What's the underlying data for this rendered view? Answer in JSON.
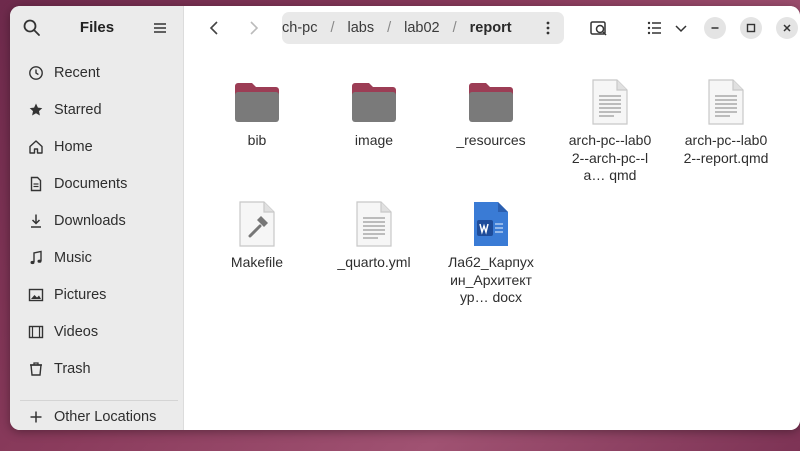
{
  "sidebar": {
    "title": "Files",
    "items": [
      {
        "label": "Recent",
        "icon": "clock-icon"
      },
      {
        "label": "Starred",
        "icon": "star-icon"
      },
      {
        "label": "Home",
        "icon": "home-icon"
      },
      {
        "label": "Documents",
        "icon": "document-icon"
      },
      {
        "label": "Downloads",
        "icon": "download-icon"
      },
      {
        "label": "Music",
        "icon": "music-note-icon"
      },
      {
        "label": "Pictures",
        "icon": "picture-icon"
      },
      {
        "label": "Videos",
        "icon": "film-icon"
      },
      {
        "label": "Trash",
        "icon": "trash-icon"
      },
      {
        "label": "Other Locations",
        "icon": "plus-icon"
      }
    ]
  },
  "header": {
    "path": [
      "ch-pc",
      "labs",
      "lab02",
      "report"
    ],
    "separator": "/"
  },
  "files": [
    {
      "name": "bib",
      "type": "folder"
    },
    {
      "name": "image",
      "type": "folder"
    },
    {
      "name": "_resources",
      "type": "folder"
    },
    {
      "name": "arch-pc--lab02--arch-pc--la… qmd",
      "type": "text"
    },
    {
      "name": "arch-pc--lab02--report.qmd",
      "type": "text"
    },
    {
      "name": "Makefile",
      "type": "makefile"
    },
    {
      "name": "_quarto.yml",
      "type": "text"
    },
    {
      "name": "Лаб2_Карпухин_Архитектур… docx",
      "type": "word"
    }
  ],
  "colors": {
    "folder": "#9c3d55",
    "folder_body": "#7a7a7a",
    "accent": "#2b5797"
  }
}
